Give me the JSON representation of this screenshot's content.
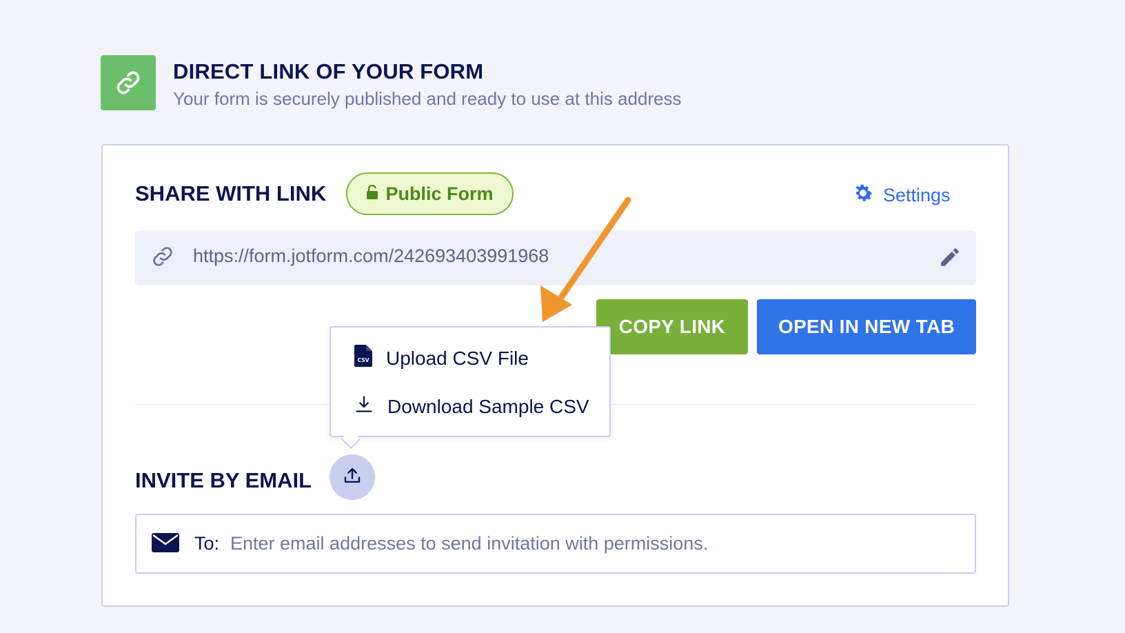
{
  "header": {
    "title": "DIRECT LINK OF YOUR FORM",
    "subtitle": "Your form is securely published and ready to use at this address",
    "icon": "link-icon"
  },
  "share": {
    "title": "SHARE WITH LINK",
    "badge_label": "Public Form",
    "badge_icon": "unlock-icon",
    "settings_label": "Settings",
    "url": "https://form.jotform.com/242693403991968",
    "copy_label": "COPY LINK",
    "open_label": "OPEN IN NEW TAB"
  },
  "dropdown": {
    "items": [
      {
        "label": "Upload CSV File",
        "icon": "csv-file-icon"
      },
      {
        "label": "Download Sample CSV",
        "icon": "download-icon"
      }
    ]
  },
  "invite": {
    "title": "INVITE BY EMAIL",
    "to_label": "To:",
    "placeholder": "Enter email addresses to send invitation with permissions."
  },
  "colors": {
    "accent_blue": "#2f74e8",
    "accent_green": "#78b03a",
    "annotation_arrow": "#f0962e"
  }
}
